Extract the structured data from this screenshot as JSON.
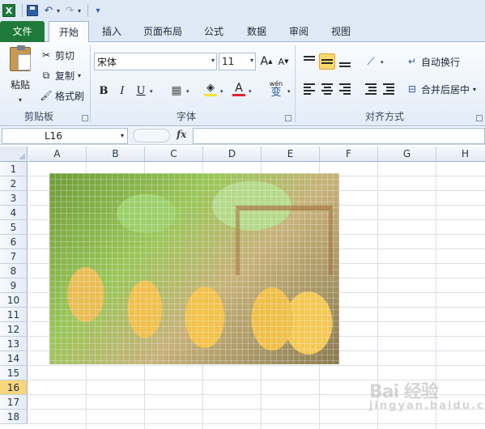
{
  "app": {
    "icon_letter": "X"
  },
  "quick_access": {
    "undo_icon": "undo-icon",
    "redo_icon": "redo-icon"
  },
  "tabs": [
    {
      "label": "文件"
    },
    {
      "label": "开始"
    },
    {
      "label": "插入"
    },
    {
      "label": "页面布局"
    },
    {
      "label": "公式"
    },
    {
      "label": "数据"
    },
    {
      "label": "审阅"
    },
    {
      "label": "视图"
    }
  ],
  "clipboard": {
    "paste": "粘贴",
    "cut": "剪切",
    "copy": "复制",
    "format_painter": "格式刷",
    "group_label": "剪贴板"
  },
  "font": {
    "name": "宋体",
    "size": "11",
    "bold": "B",
    "italic": "I",
    "underline": "U",
    "font_color_glyph": "A",
    "phonetic": "wén",
    "phonetic_char": "变",
    "group_label": "字体",
    "grow": "A",
    "shrink": "A"
  },
  "alignment": {
    "wrap_text": "自动换行",
    "merge_center": "合并后居中",
    "group_label": "对齐方式"
  },
  "formula_bar": {
    "name_box": "L16",
    "fx": "fx",
    "value": ""
  },
  "columns": [
    "A",
    "B",
    "C",
    "D",
    "E",
    "F",
    "G",
    "H"
  ],
  "rows": [
    "1",
    "2",
    "3",
    "4",
    "5",
    "6",
    "7",
    "8",
    "9",
    "10",
    "11",
    "12",
    "13",
    "14",
    "15",
    "16",
    "17",
    "18"
  ],
  "selected_row": "16",
  "colors": {
    "file_tab": "#1f7a3a",
    "selection": "#f8d67b",
    "accent_underline": "#e0242a",
    "fill_yellow": "#f5e33a"
  },
  "watermark": {
    "text": "Bai 经验",
    "subtext": "jingyan.baidu.com"
  }
}
